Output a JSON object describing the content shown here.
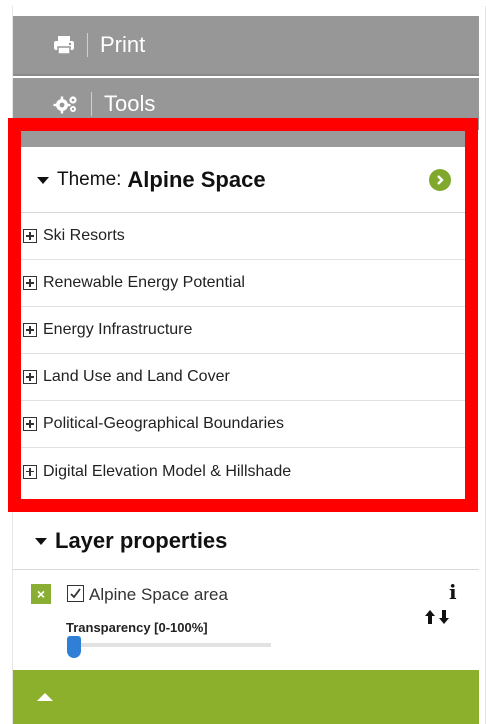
{
  "menu": {
    "print_label": "Print",
    "tools_label": "Tools"
  },
  "theme": {
    "label": "Theme:",
    "name": "Alpine Space",
    "layers": [
      "Ski Resorts",
      "Renewable Energy Potential",
      "Energy Infrastructure",
      "Land Use and Land Cover",
      "Political-Geographical Boundaries",
      "Digital Elevation Model & Hillshade"
    ]
  },
  "layer_properties": {
    "title": "Layer properties",
    "layer": {
      "name": "Alpine Space area",
      "checked": true,
      "remove_label": "×",
      "info_label": "i",
      "transparency_label": "Transparency [0-100%]",
      "transparency_value": 0
    }
  },
  "colors": {
    "accent_green": "#8db02c",
    "highlight_red": "#ff0000",
    "menu_gray": "#979797",
    "slider_blue": "#2f7fd6"
  }
}
